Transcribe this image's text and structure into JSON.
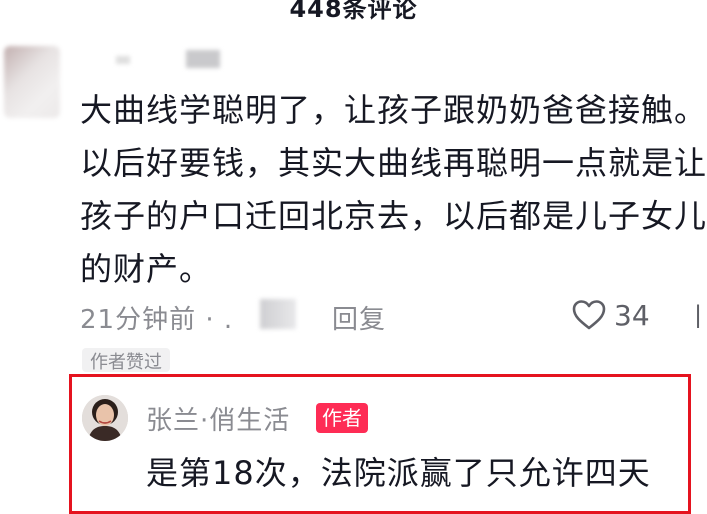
{
  "header": {
    "title": "448条评论"
  },
  "comment": {
    "text": "大曲线学聪明了，让孩子跟奶奶爸爸接触。以后好要钱，其实大曲线再聪明一点就是让孩子的户口迁回北京去，以后都是儿子女儿的财产。",
    "time": "21分钟前 · .",
    "reply_label": "回复",
    "like_count": "34",
    "author_liked_label": "作者赞过"
  },
  "reply": {
    "username": "张兰·俏生活",
    "badge": "作者",
    "text": "是第18次，法院派赢了只允许四天"
  },
  "colors": {
    "highlight_border": "#e5131f",
    "author_badge_bg": "#fe2c55",
    "secondary_text": "#8a8b91",
    "primary_text": "#161823"
  }
}
